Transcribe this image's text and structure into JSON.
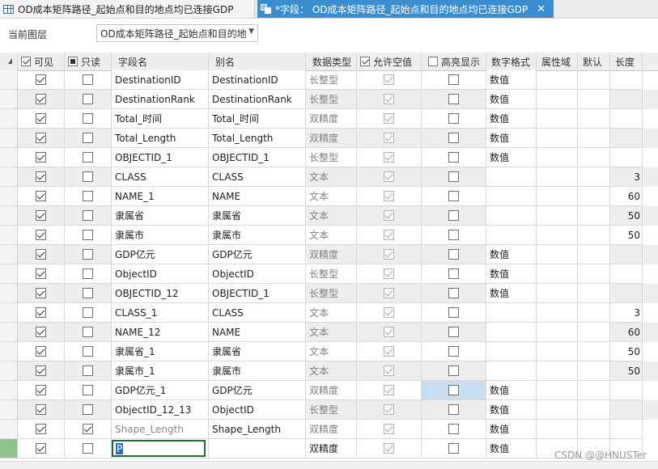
{
  "tabs": [
    {
      "label": "OD成本矩阵路径_起始点和目的地点均已连接GDP",
      "icon": "table-icon",
      "active": false
    },
    {
      "label": "*字段：  OD成本矩阵路径_起始点和目的地点均已连接GDP",
      "icon": "fields-icon",
      "active": true,
      "close": "✕"
    }
  ],
  "layer": {
    "label": "当前图层",
    "value": "OD成本矩阵路径_起始点和目的地"
  },
  "headers": {
    "visible": "可见",
    "readonly": "只读",
    "field_name": "字段名",
    "alias": "别名",
    "data_type": "数据类型",
    "allow_null": "允许空值",
    "highlight": "高亮显示",
    "number_format": "数字格式",
    "domain": "属性域",
    "default": "默认",
    "length": "长度"
  },
  "rows": [
    {
      "visible": true,
      "readonly": false,
      "name": "DestinationID",
      "alias": "DestinationID",
      "type": "长整型",
      "allow_null": true,
      "highlight": false,
      "format": "数值",
      "length": ""
    },
    {
      "visible": true,
      "readonly": false,
      "name": "DestinationRank",
      "alias": "DestinationRank",
      "type": "长整型",
      "allow_null": true,
      "highlight": false,
      "format": "数值",
      "length": ""
    },
    {
      "visible": true,
      "readonly": false,
      "name": "Total_时间",
      "alias": "Total_时间",
      "type": "双精度",
      "allow_null": true,
      "highlight": false,
      "format": "数值",
      "length": ""
    },
    {
      "visible": true,
      "readonly": false,
      "name": "Total_Length",
      "alias": "Total_Length",
      "type": "双精度",
      "allow_null": true,
      "highlight": false,
      "format": "数值",
      "length": ""
    },
    {
      "visible": true,
      "readonly": false,
      "name": "OBJECTID_1",
      "alias": "OBJECTID_1",
      "type": "长整型",
      "allow_null": true,
      "highlight": false,
      "format": "数值",
      "length": ""
    },
    {
      "visible": true,
      "readonly": false,
      "name": "CLASS",
      "alias": "CLASS",
      "type": "文本",
      "allow_null": true,
      "highlight": false,
      "format": "",
      "length": "3"
    },
    {
      "visible": true,
      "readonly": false,
      "name": "NAME_1",
      "alias": "NAME",
      "type": "文本",
      "allow_null": true,
      "highlight": false,
      "format": "",
      "length": "60"
    },
    {
      "visible": true,
      "readonly": false,
      "name": "隶属省",
      "alias": "隶属省",
      "type": "文本",
      "allow_null": true,
      "highlight": false,
      "format": "",
      "length": "50"
    },
    {
      "visible": true,
      "readonly": false,
      "name": "隶属市",
      "alias": "隶属市",
      "type": "文本",
      "allow_null": true,
      "highlight": false,
      "format": "",
      "length": "50"
    },
    {
      "visible": true,
      "readonly": false,
      "name": "GDP亿元",
      "alias": "GDP亿元",
      "type": "双精度",
      "allow_null": true,
      "highlight": false,
      "format": "数值",
      "length": ""
    },
    {
      "visible": true,
      "readonly": false,
      "name": "ObjectID",
      "alias": "ObjectID",
      "type": "长整型",
      "allow_null": true,
      "highlight": false,
      "format": "数值",
      "length": ""
    },
    {
      "visible": true,
      "readonly": false,
      "name": "OBJECTID_12",
      "alias": "OBJECTID_1",
      "type": "长整型",
      "allow_null": true,
      "highlight": false,
      "format": "数值",
      "length": ""
    },
    {
      "visible": true,
      "readonly": false,
      "name": "CLASS_1",
      "alias": "CLASS",
      "type": "文本",
      "allow_null": true,
      "highlight": false,
      "format": "",
      "length": "3"
    },
    {
      "visible": true,
      "readonly": false,
      "name": "NAME_12",
      "alias": "NAME",
      "type": "文本",
      "allow_null": true,
      "highlight": false,
      "format": "",
      "length": "60"
    },
    {
      "visible": true,
      "readonly": false,
      "name": "隶属省_1",
      "alias": "隶属省",
      "type": "文本",
      "allow_null": true,
      "highlight": false,
      "format": "",
      "length": "50"
    },
    {
      "visible": true,
      "readonly": false,
      "name": "隶属市_1",
      "alias": "隶属市",
      "type": "文本",
      "allow_null": true,
      "highlight": false,
      "format": "",
      "length": "50"
    },
    {
      "visible": true,
      "readonly": false,
      "name": "GDP亿元_1",
      "alias": "GDP亿元",
      "type": "双精度",
      "allow_null": true,
      "highlight": false,
      "format": "数值",
      "length": "",
      "selected_highlight": true
    },
    {
      "visible": true,
      "readonly": false,
      "name": "ObjectID_12_13",
      "alias": "ObjectID",
      "type": "长整型",
      "allow_null": true,
      "highlight": false,
      "format": "数值",
      "length": ""
    },
    {
      "visible": true,
      "readonly": true,
      "name": "Shape_Length",
      "alias": "Shape_Length",
      "type": "双精度",
      "allow_null": true,
      "highlight": false,
      "format": "数值",
      "length": "",
      "name_grey": true
    },
    {
      "visible": true,
      "readonly": false,
      "name": "P",
      "alias": "",
      "type": "双精度",
      "allow_null": true,
      "highlight": false,
      "format": "数值",
      "length": "",
      "editing": true
    }
  ],
  "watermark": "CSDN @@HNUSTer"
}
